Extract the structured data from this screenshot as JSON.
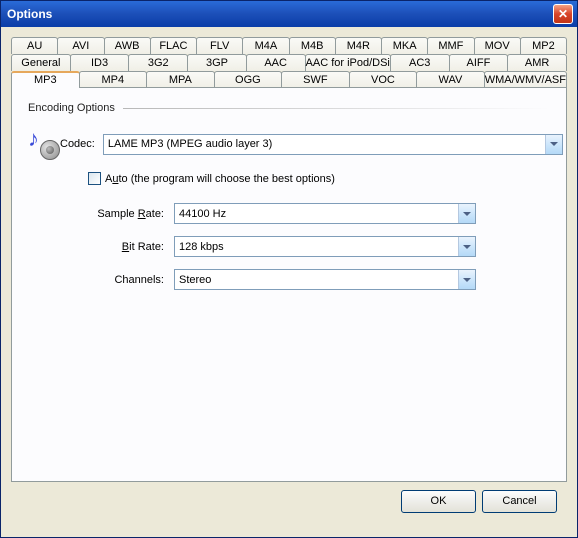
{
  "window": {
    "title": "Options"
  },
  "tab_rows": [
    [
      "AU",
      "AVI",
      "AWB",
      "FLAC",
      "FLV",
      "M4A",
      "M4B",
      "M4R",
      "MKA",
      "MMF",
      "MOV",
      "MP2"
    ],
    [
      "General",
      "ID3",
      "3G2",
      "3GP",
      "AAC",
      "AAC for iPod/DSi",
      "AC3",
      "AIFF",
      "AMR"
    ],
    [
      "MP3",
      "MP4",
      "MPA",
      "OGG",
      "SWF",
      "VOC",
      "WAV",
      "WMA/WMV/ASF"
    ]
  ],
  "active_tab": "MP3",
  "section": {
    "title": "Encoding Options"
  },
  "codec": {
    "label": "Codec:",
    "value": "LAME MP3 (MPEG audio layer 3)"
  },
  "auto": {
    "checked": false,
    "label_pre": "A",
    "label_u": "u",
    "label_post": "to (the program will choose the best options)"
  },
  "sample_rate": {
    "label_pre": "Sample ",
    "label_u": "R",
    "label_post": "ate:",
    "value": "44100 Hz"
  },
  "bit_rate": {
    "label_u": "B",
    "label_post": "it Rate:",
    "value": "128 kbps"
  },
  "channels": {
    "label": "Channels:",
    "value": "Stereo"
  },
  "buttons": {
    "ok": "OK",
    "cancel": "Cancel"
  }
}
